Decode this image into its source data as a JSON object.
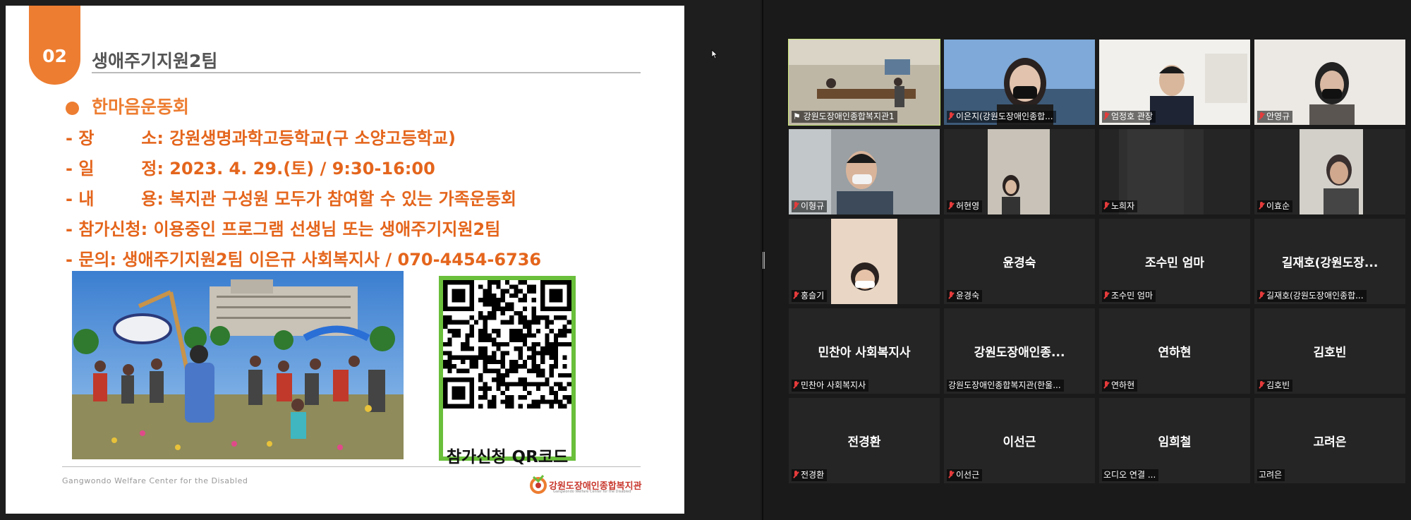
{
  "slide": {
    "tab_number": "02",
    "title": "생애주기지원2팀",
    "subtitle": "한마음운동회",
    "lines": [
      "- 장        소: 강원생명과학고등학교(구 소양고등학교)",
      "- 일        정: 2023. 4. 29.(토) / 9:30-16:00",
      "- 내        용: 복지관 구성원 모두가 참여할 수 있는 가족운동회",
      "- 참가신청: 이용중인 프로그램 선생님 또는 생애주기지원2팀",
      "- 문의: 생애주기지원2팀 이은규 사회복지사 / 070-4454-6736"
    ],
    "qr_caption": "참가신청 QR코드",
    "footer": "Gangwondo Welfare Center for the Disabled",
    "logo_text": "강원도장애인종합복지관",
    "logo_sub": "Gangwondo Welfare Center for the Disabled"
  },
  "colors": {
    "accent": "#ed7d31",
    "qr_border": "#6abf3b",
    "active_speaker": "#cbe87a",
    "muted_mic": "#e53b3b"
  },
  "participants": [
    {
      "name": "",
      "label": "강원도장애인종합복지관1",
      "video": true,
      "muted": false,
      "speaking": true
    },
    {
      "name": "",
      "label": "이은지(강원도장애인종합...",
      "video": true,
      "muted": true
    },
    {
      "name": "",
      "label": "엄정호 관장",
      "video": true,
      "muted": true
    },
    {
      "name": "",
      "label": "안영규",
      "video": true,
      "muted": true
    },
    {
      "name": "",
      "label": "이형규",
      "video": true,
      "muted": true
    },
    {
      "name": "",
      "label": "허현영",
      "video": true,
      "muted": true
    },
    {
      "name": "",
      "label": "노희자",
      "video": true,
      "muted": true
    },
    {
      "name": "",
      "label": "이효순",
      "video": true,
      "muted": true
    },
    {
      "name": "",
      "label": "홍슬기",
      "video": true,
      "muted": true
    },
    {
      "name": "윤경숙",
      "label": "윤경숙",
      "video": false,
      "muted": true
    },
    {
      "name": "조수민 엄마",
      "label": "조수민 엄마",
      "video": false,
      "muted": true
    },
    {
      "name": "길재호(강원도장...",
      "label": "길재호(강원도장애인종합...",
      "video": false,
      "muted": true
    },
    {
      "name": "민찬아 사회복지사",
      "label": "민찬아 사회복지사",
      "video": false,
      "muted": true
    },
    {
      "name": "강원도장애인종...",
      "label": "강원도장애인종합복지관(한울...",
      "video": false,
      "muted": false
    },
    {
      "name": "연하현",
      "label": "연하현",
      "video": false,
      "muted": true
    },
    {
      "name": "김호빈",
      "label": "김호빈",
      "video": false,
      "muted": true
    },
    {
      "name": "전경환",
      "label": "전경환",
      "video": false,
      "muted": true
    },
    {
      "name": "이선근",
      "label": "이선근",
      "video": false,
      "muted": true
    },
    {
      "name": "임희철",
      "label": "오디오 연결 ...",
      "video": false,
      "muted": false
    },
    {
      "name": "고려은",
      "label": "고려은",
      "video": false,
      "muted": false
    }
  ]
}
